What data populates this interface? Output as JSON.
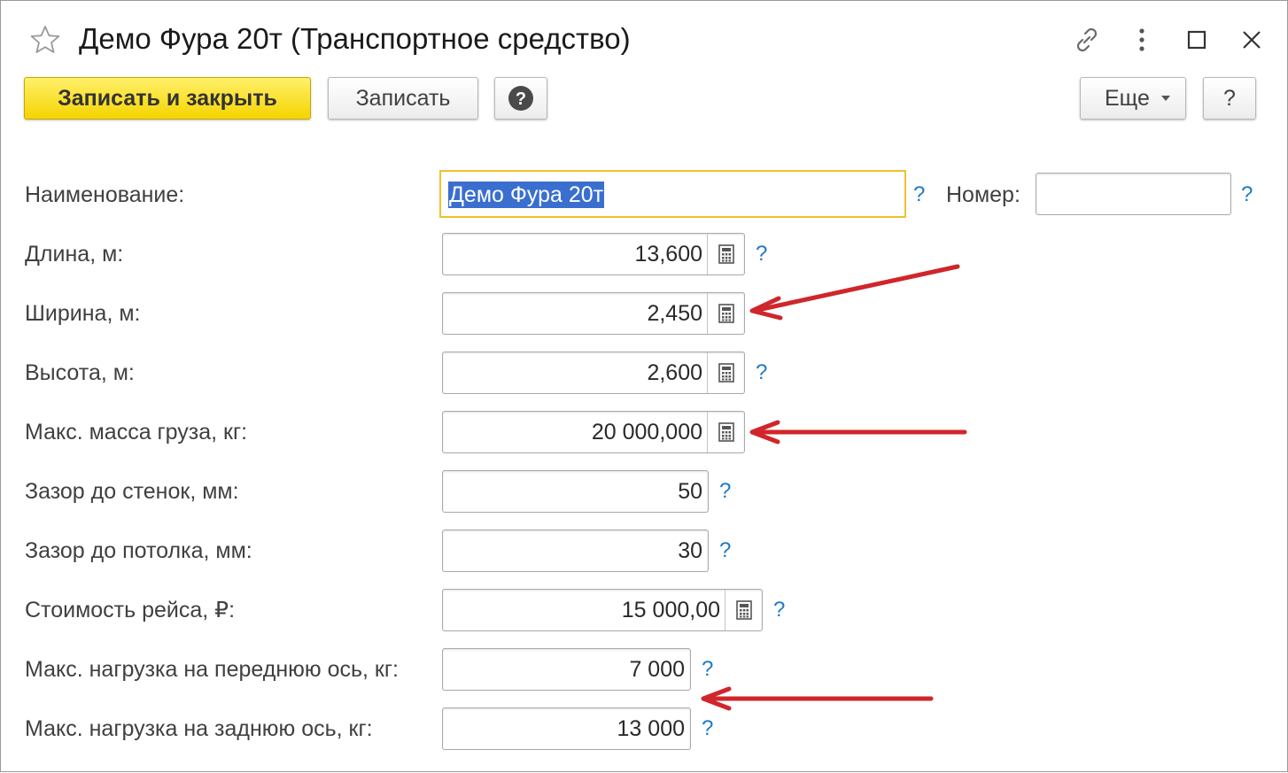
{
  "window": {
    "title": "Демо Фура 20т (Транспортное средство)"
  },
  "toolbar": {
    "save_close": "Записать и закрыть",
    "save": "Записать",
    "more": "Еще",
    "help": "?"
  },
  "form": {
    "name": {
      "label": "Наименование:",
      "value": "Демо Фура 20т"
    },
    "number": {
      "label": "Номер:",
      "value": ""
    },
    "hint": "?",
    "fields": [
      {
        "label": "Длина, м:",
        "value": "13,600"
      },
      {
        "label": "Ширина, м:",
        "value": "2,450"
      },
      {
        "label": "Высота, м:",
        "value": "2,600"
      },
      {
        "label": "Макс. масса груза, кг:",
        "value": "20 000,000"
      },
      {
        "label": "Зазор до стенок, мм:",
        "value": "50"
      },
      {
        "label": "Зазор до потолка, мм:",
        "value": "30"
      },
      {
        "label": "Стоимость рейса, ₽:",
        "value": "15 000,00"
      },
      {
        "label": "Макс. нагрузка на переднюю ось, кг:",
        "value": "7 000"
      },
      {
        "label": "Макс. нагрузка на заднюю ось, кг:",
        "value": "13 000"
      }
    ]
  },
  "icons": {
    "favorite": "star-icon",
    "link": "link-icon",
    "menu": "more-vertical-icon",
    "maximize": "maximize-icon",
    "close": "close-icon",
    "calculator": "calculator-icon",
    "help": "help-circle-icon",
    "dropdown": "chevron-down-icon"
  },
  "colors": {
    "primary_button": "#f5d400",
    "hint": "#1f7ac8",
    "annotation_arrow": "#d0262b",
    "focus_border": "#f0c030",
    "selection": "#3a6fd0"
  }
}
